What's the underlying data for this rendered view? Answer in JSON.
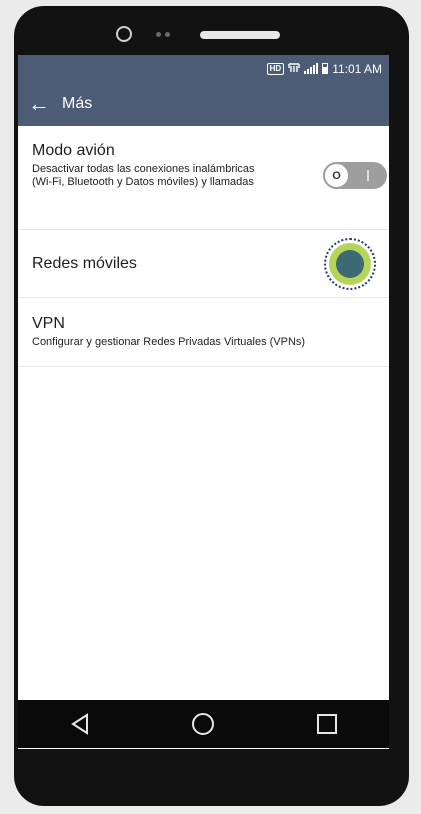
{
  "status_bar": {
    "hd_label": "HD",
    "time": "11:01 AM",
    "icons": [
      "hd-icon",
      "network-icon",
      "signal-icon",
      "battery-icon"
    ]
  },
  "app_bar": {
    "back_icon": "arrow-left-icon",
    "title": "Más",
    "background_color": "#4d5c75"
  },
  "settings": {
    "airplane": {
      "title": "Modo avión",
      "subtitle": "Desactivar todas las conexiones inalámbricas (Wi-Fi, Bluetooth y Datos móviles) y llamadas",
      "toggle_state": "off",
      "toggle_knob_label": "O"
    },
    "mobile_networks": {
      "title": "Redes móviles",
      "tap_indicator_color": "#b7d45a"
    },
    "vpn": {
      "title": "VPN",
      "subtitle": "Configurar y gestionar Redes Privadas Virtuales (VPNs)"
    }
  },
  "nav_bar": {
    "items": [
      "back-triangle-icon",
      "home-circle-icon",
      "recents-square-icon"
    ]
  }
}
